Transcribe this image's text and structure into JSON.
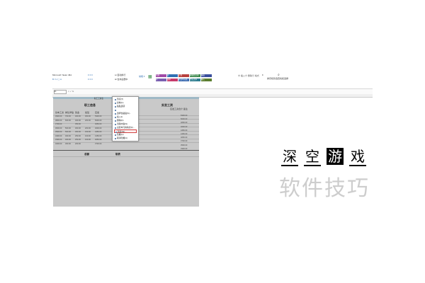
{
  "ribbon": {
    "font_name": "Microsoft YaHei UI",
    "font_size": "11",
    "styles": [
      {
        "label": "常规",
        "color": "#a14aa6"
      },
      {
        "label": "好",
        "color": "#7a5fb0"
      },
      {
        "label": "差",
        "color": "#2f6fb3"
      },
      {
        "label": "适中",
        "color": "#c63a6a"
      },
      {
        "label": "计算",
        "color": "#b8403d"
      },
      {
        "label": "检查单元格",
        "color": "#3c6bb0"
      },
      {
        "label": "解释性文本",
        "color": "#3f8a4f"
      },
      {
        "label": "警告文本",
        "color": "#2d7d8f"
      },
      {
        "label": "输出",
        "color": "#3a4f9c"
      },
      {
        "label": "输入",
        "color": "#5a7d2f"
      }
    ],
    "sort_label": "排序和筛选",
    "find_label": "查找和选择"
  },
  "formula_bar": {
    "cell": "A1"
  },
  "sheet": {
    "banner": "职工工资表",
    "left_title": "职工信息",
    "right_title": "实发工资",
    "right_header": "应发工资合计   备注",
    "columns": [
      "基本工资",
      "岗位津贴",
      "奖金",
      "加班",
      "应发"
    ],
    "rows": [
      [
        "3900.00",
        "700.00",
        "400.00",
        "300.00",
        "5300.00"
      ],
      [
        "3800.00",
        "600.00",
        "400.00",
        "200.00",
        "5000.00"
      ],
      [
        "3700.00",
        "",
        "350.00",
        "",
        "4050.00"
      ],
      [
        "3600.00",
        "500.00",
        "300.00",
        "200.00",
        "4600.00"
      ],
      [
        "3500.00",
        "500.00",
        "300.00",
        "150.00",
        "4450.00"
      ],
      [
        "3400.00",
        "400.00",
        "250.00",
        "100.00",
        "4150.00"
      ],
      [
        "3300.00",
        "400.00",
        "250.00",
        "100.00",
        "4050.00"
      ],
      [
        "3200.00",
        "300.00",
        "200.00",
        "",
        "3700.00"
      ]
    ],
    "right_values": [
      "5300.00",
      "5000.00",
      "4050.00",
      "4600.00",
      "4450.00",
      "4150.00",
      "4050.00",
      "3700.00",
      "3500.00",
      "3300.00"
    ],
    "bottom_left": "总额",
    "bottom_right": "制表"
  },
  "context_menu": {
    "items": [
      "剪切(T)",
      "复制(C)",
      "粘贴选项:",
      "",
      "选择性粘贴(S)...",
      "插入(I)",
      "删除(D)",
      "清除内容(N)",
      "设置单元格格式(F)...",
      "列宽(W)...",
      "隐藏(H)",
      "取消隐藏(U)"
    ],
    "selected_index": 9
  },
  "watermark": {
    "logo_chars": [
      "深",
      "空",
      "游",
      "戏"
    ],
    "subtitle": "软件技巧"
  }
}
